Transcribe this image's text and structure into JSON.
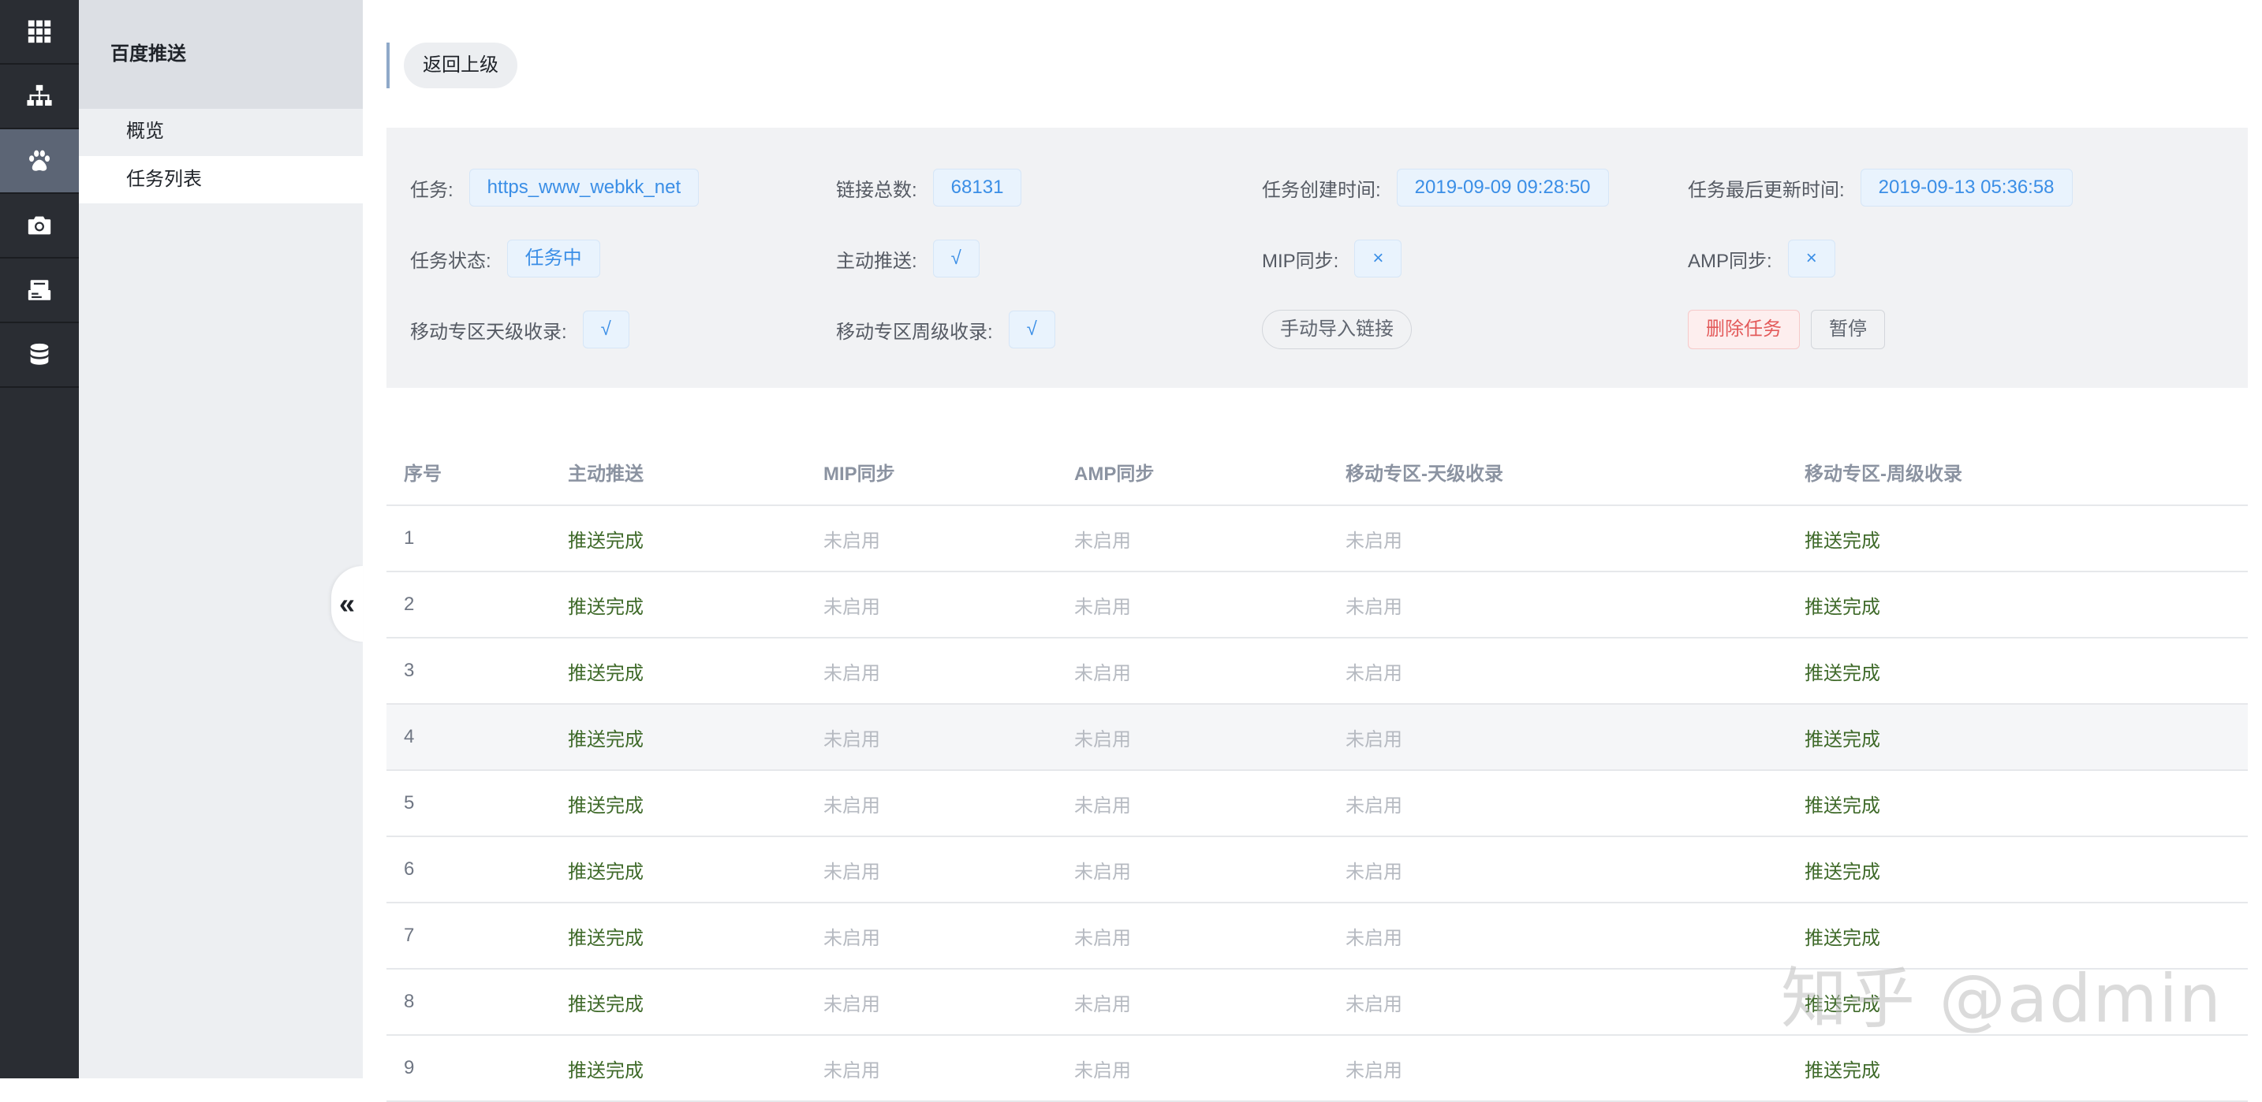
{
  "rail": {
    "items": [
      {
        "icon": "apps-grid-icon"
      },
      {
        "icon": "sitemap-icon"
      },
      {
        "icon": "paw-icon",
        "active": true
      },
      {
        "icon": "camera-icon"
      },
      {
        "icon": "users-card-icon"
      },
      {
        "icon": "database-icon"
      }
    ]
  },
  "menu": {
    "title": "百度推送",
    "items": [
      {
        "label": "概览"
      },
      {
        "label": "任务列表",
        "active": true
      }
    ],
    "collapse_glyph": "«"
  },
  "header": {
    "back_label": "返回上级"
  },
  "info": {
    "task_label": "任务:",
    "task_value": "https_www_webkk_net",
    "links_label": "链接总数:",
    "links_value": "68131",
    "created_label": "任务创建时间:",
    "created_value": "2019-09-09 09:28:50",
    "updated_label": "任务最后更新时间:",
    "updated_value": "2019-09-13 05:36:58",
    "status_label": "任务状态:",
    "status_value": "任务中",
    "push_label": "主动推送:",
    "push_value": "√",
    "mip_label": "MIP同步:",
    "mip_value": "×",
    "amp_label": "AMP同步:",
    "amp_value": "×",
    "mobile_day_label": "移动专区天级收录:",
    "mobile_day_value": "√",
    "mobile_week_label": "移动专区周级收录:",
    "mobile_week_value": "√",
    "manual_import_label": "手动导入链接",
    "delete_label": "删除任务",
    "pause_label": "暂停"
  },
  "table": {
    "columns": [
      "序号",
      "主动推送",
      "MIP同步",
      "AMP同步",
      "移动专区-天级收录",
      "移动专区-周级收录"
    ],
    "rows": [
      [
        "1",
        "推送完成",
        "未启用",
        "未启用",
        "未启用",
        "推送完成"
      ],
      [
        "2",
        "推送完成",
        "未启用",
        "未启用",
        "未启用",
        "推送完成"
      ],
      [
        "3",
        "推送完成",
        "未启用",
        "未启用",
        "未启用",
        "推送完成"
      ],
      [
        "4",
        "推送完成",
        "未启用",
        "未启用",
        "未启用",
        "推送完成"
      ],
      [
        "5",
        "推送完成",
        "未启用",
        "未启用",
        "未启用",
        "推送完成"
      ],
      [
        "6",
        "推送完成",
        "未启用",
        "未启用",
        "未启用",
        "推送完成"
      ],
      [
        "7",
        "推送完成",
        "未启用",
        "未启用",
        "未启用",
        "推送完成"
      ],
      [
        "8",
        "推送完成",
        "未启用",
        "未启用",
        "未启用",
        "推送完成"
      ],
      [
        "9",
        "推送完成",
        "未启用",
        "未启用",
        "未启用",
        "推送完成"
      ]
    ],
    "hover_row": 3
  },
  "watermark": "知乎 @admin",
  "colors": {
    "rail_bg": "#2a2d33",
    "rail_active": "#5c6575",
    "tag_blue": "#3a8ee6",
    "done_green": "#3f6a2a",
    "danger_red": "#e35a5a"
  }
}
